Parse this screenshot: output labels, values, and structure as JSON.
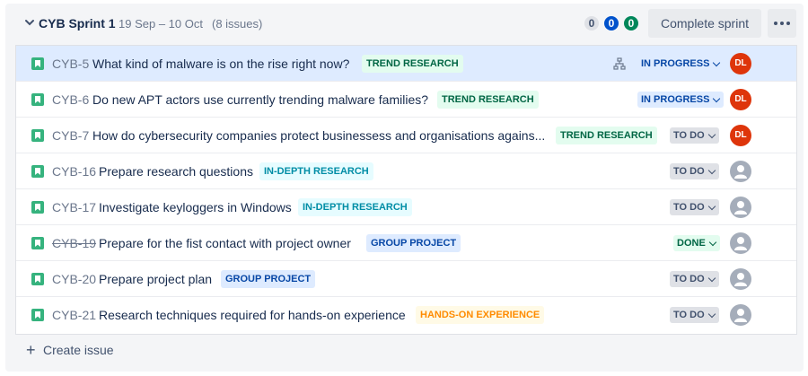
{
  "sprint": {
    "name": "CYB Sprint 1",
    "dates": "19 Sep – 10 Oct",
    "issue_count": "(8 issues)",
    "counts": {
      "todo": "0",
      "in_progress": "0",
      "done": "0"
    },
    "complete_label": "Complete sprint"
  },
  "issues": [
    {
      "key": "CYB-5",
      "summary": "What kind of malware is on the rise right now?",
      "epic": "TREND RESEARCH",
      "status": "IN PROGRESS",
      "assignee": "DL"
    },
    {
      "key": "CYB-6",
      "summary": "Do new APT actors use currently trending malware families?",
      "epic": "TREND RESEARCH",
      "status": "IN PROGRESS",
      "assignee": "DL"
    },
    {
      "key": "CYB-7",
      "summary": "How do cybersecurity companies protect businessess and organisations agains...",
      "epic": "TREND RESEARCH",
      "status": "TO DO",
      "assignee": "DL"
    },
    {
      "key": "CYB-16",
      "summary": "Prepare research questions",
      "epic": "IN-DEPTH RESEARCH",
      "status": "TO DO",
      "assignee": ""
    },
    {
      "key": "CYB-17",
      "summary": "Investigate keyloggers in Windows",
      "epic": "IN-DEPTH RESEARCH",
      "status": "TO DO",
      "assignee": ""
    },
    {
      "key": "CYB-19",
      "summary": "Prepare for the fist contact with project owner",
      "epic": "GROUP PROJECT",
      "status": "DONE",
      "assignee": ""
    },
    {
      "key": "CYB-20",
      "summary": "Prepare project plan",
      "epic": "GROUP PROJECT",
      "status": "TO DO",
      "assignee": ""
    },
    {
      "key": "CYB-21",
      "summary": "Research techniques required for hands-on experience",
      "epic": "HANDS-ON EXPERIENCE",
      "status": "TO DO",
      "assignee": ""
    }
  ],
  "create_issue_label": "Create issue"
}
